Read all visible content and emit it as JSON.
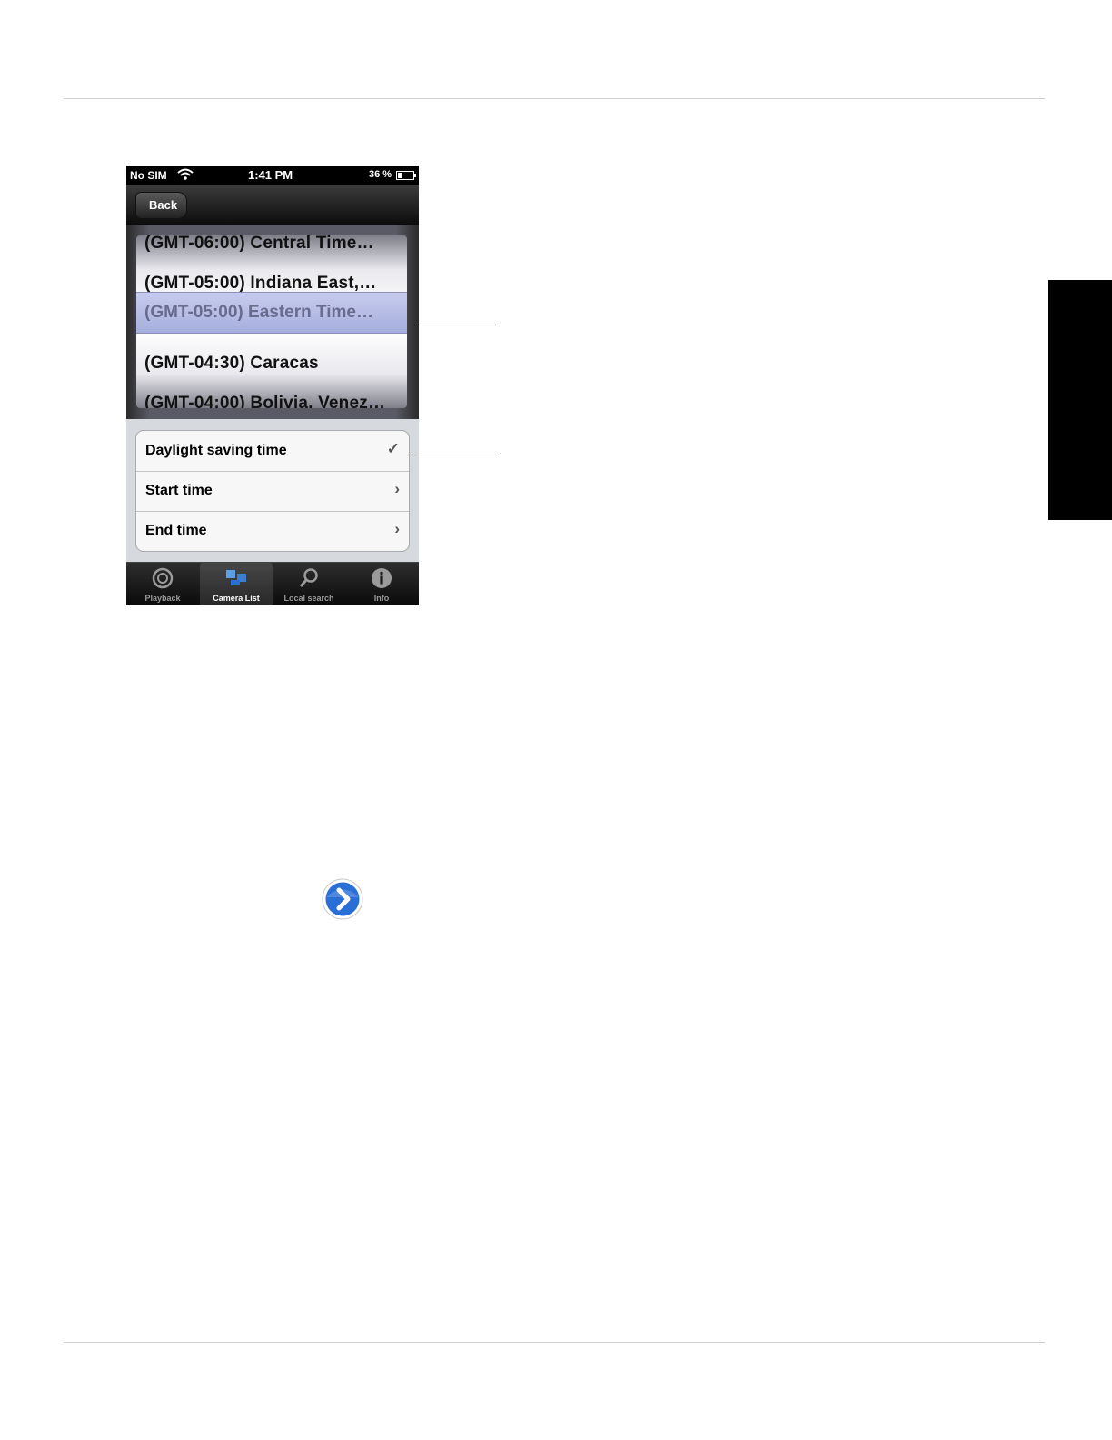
{
  "status_bar": {
    "carrier": "No SIM",
    "time": "1:41 PM",
    "battery": "36 %"
  },
  "nav_bar": {
    "back_label": "Back"
  },
  "timezone_picker": {
    "rows": [
      "(GMT-06:00) Central Time…",
      "(GMT-05:00) Indiana East,…",
      "(GMT-05:00) Eastern Time…",
      "(GMT-04:30) Caracas",
      "(GMT-04:00) Bolivia, Venez…"
    ],
    "selected": "(GMT-05:00) Eastern Time…"
  },
  "settings": {
    "daylight_saving": "Daylight saving time",
    "daylight_saving_check": "✓",
    "start_time": "Start time",
    "end_time": "End time",
    "chevron": "›"
  },
  "tab_bar": {
    "tabs": [
      {
        "label": "Playback",
        "icon": "playback-icon"
      },
      {
        "label": "Camera List",
        "icon": "camera-list-icon"
      },
      {
        "label": "Local search",
        "icon": "search-icon"
      },
      {
        "label": "Info",
        "icon": "info-icon"
      }
    ],
    "selected_tab": "Camera List"
  },
  "colors": {
    "side_tab": "#000000",
    "disclosure_blue": "#2a6fd6"
  }
}
